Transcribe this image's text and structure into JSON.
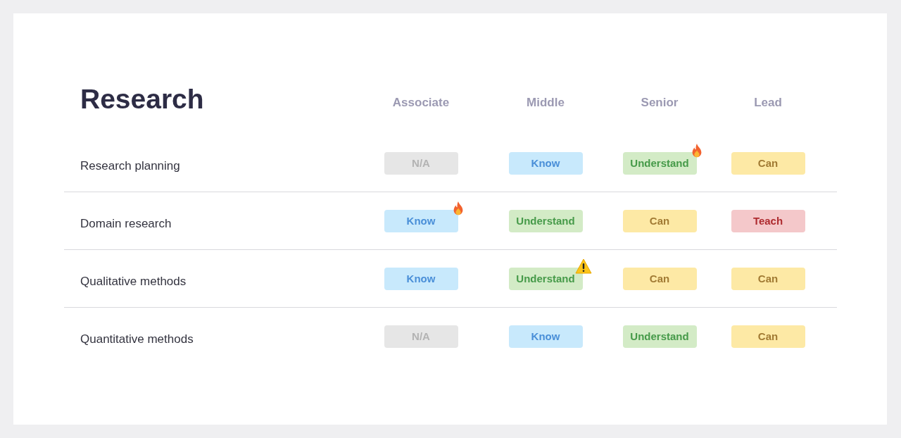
{
  "title": "Research",
  "columns": [
    "Associate",
    "Middle",
    "Senior",
    "Lead"
  ],
  "rows": [
    {
      "label": "Research planning",
      "cells": [
        {
          "kind": "na",
          "text": "N/A",
          "hot": false,
          "warning": false
        },
        {
          "kind": "know",
          "text": "Know",
          "hot": false,
          "warning": false
        },
        {
          "kind": "understand",
          "text": "Understand",
          "hot": true,
          "warning": false
        },
        {
          "kind": "can",
          "text": "Can",
          "hot": false,
          "warning": false
        }
      ]
    },
    {
      "label": "Domain research",
      "cells": [
        {
          "kind": "know",
          "text": "Know",
          "hot": true,
          "warning": false
        },
        {
          "kind": "understand",
          "text": "Understand",
          "hot": false,
          "warning": false
        },
        {
          "kind": "can",
          "text": "Can",
          "hot": false,
          "warning": false
        },
        {
          "kind": "teach",
          "text": "Teach",
          "hot": false,
          "warning": false
        }
      ]
    },
    {
      "label": "Qualitative methods",
      "cells": [
        {
          "kind": "know",
          "text": "Know",
          "hot": false,
          "warning": false
        },
        {
          "kind": "understand",
          "text": "Understand",
          "hot": false,
          "warning": true
        },
        {
          "kind": "can",
          "text": "Can",
          "hot": false,
          "warning": false
        },
        {
          "kind": "can",
          "text": "Can",
          "hot": false,
          "warning": false
        }
      ]
    },
    {
      "label": "Quantitative methods",
      "cells": [
        {
          "kind": "na",
          "text": "N/A",
          "hot": false,
          "warning": false
        },
        {
          "kind": "know",
          "text": "Know",
          "hot": false,
          "warning": false
        },
        {
          "kind": "understand",
          "text": "Understand",
          "hot": false,
          "warning": false
        },
        {
          "kind": "can",
          "text": "Can",
          "hot": false,
          "warning": false
        }
      ]
    }
  ]
}
